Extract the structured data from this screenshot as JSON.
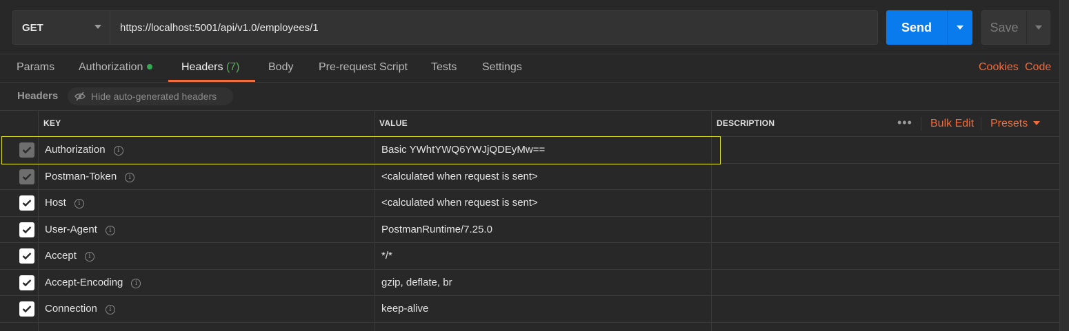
{
  "request": {
    "method": "GET",
    "url": "https://localhost:5001/api/v1.0/employees/1",
    "send_label": "Send",
    "save_label": "Save"
  },
  "tabs": [
    {
      "label": "Params"
    },
    {
      "label": "Authorization",
      "indicator": "green-dot"
    },
    {
      "label": "Headers",
      "count": "(7)",
      "active": true
    },
    {
      "label": "Body"
    },
    {
      "label": "Pre-request Script"
    },
    {
      "label": "Tests"
    },
    {
      "label": "Settings"
    }
  ],
  "tab_links": {
    "cookies": "Cookies",
    "code": "Code"
  },
  "headers_section": {
    "title": "Headers",
    "toggle_label": "Hide auto-generated headers"
  },
  "table": {
    "columns": {
      "key": "KEY",
      "value": "VALUE",
      "description": "DESCRIPTION"
    },
    "more_label": "•••",
    "bulk_edit": "Bulk Edit",
    "presets": "Presets",
    "rows": [
      {
        "key": "Authorization",
        "value": "Basic YWhtYWQ6YWJjQDEyMw==",
        "checked": true,
        "auto": true
      },
      {
        "key": "Postman-Token",
        "value": "<calculated when request is sent>",
        "checked": true,
        "auto": true
      },
      {
        "key": "Host",
        "value": "<calculated when request is sent>",
        "checked": true,
        "auto": false
      },
      {
        "key": "User-Agent",
        "value": "PostmanRuntime/7.25.0",
        "checked": true,
        "auto": false
      },
      {
        "key": "Accept",
        "value": "*/*",
        "checked": true,
        "auto": false
      },
      {
        "key": "Accept-Encoding",
        "value": "gzip, deflate, br",
        "checked": true,
        "auto": false
      },
      {
        "key": "Connection",
        "value": "keep-alive",
        "checked": true,
        "auto": false
      }
    ]
  },
  "colors": {
    "accent": "#f26b3a",
    "send_button": "#097bed",
    "highlight_border": "#e3e32b",
    "status_dot": "#34a853"
  }
}
